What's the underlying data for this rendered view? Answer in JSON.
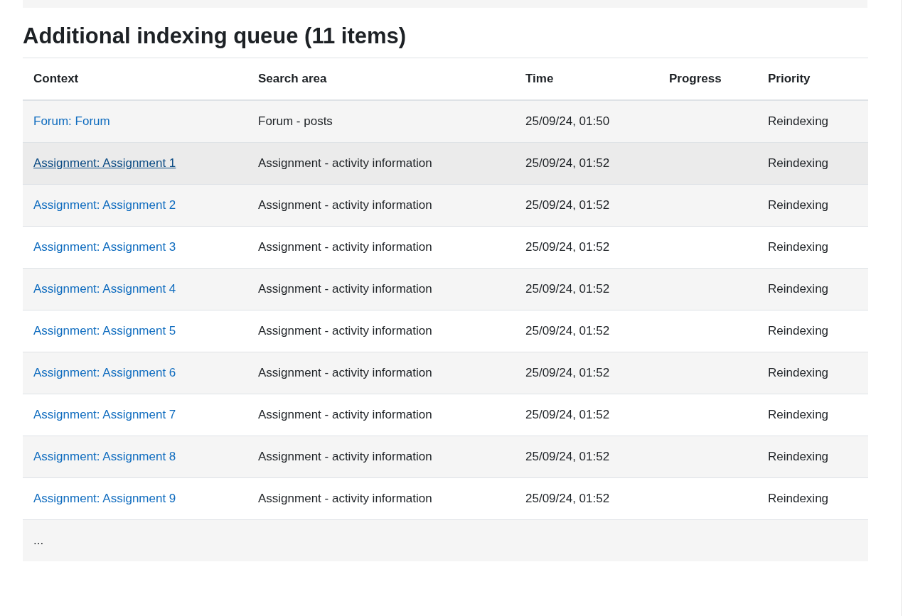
{
  "heading": "Additional indexing queue (11 items)",
  "table": {
    "columns": [
      "Context",
      "Search area",
      "Time",
      "Progress",
      "Priority"
    ],
    "rows": [
      {
        "kind": "entry",
        "hovered": false,
        "context": "Forum: Forum",
        "search_area": "Forum - posts",
        "time": "25/09/24, 01:50",
        "priority": "Reindexing"
      },
      {
        "kind": "entry",
        "hovered": true,
        "context": "Assignment: Assignment 1",
        "search_area": "Assignment - activity information",
        "time": "25/09/24, 01:52",
        "priority": "Reindexing"
      },
      {
        "kind": "entry",
        "hovered": false,
        "context": "Assignment: Assignment 2",
        "search_area": "Assignment - activity information",
        "time": "25/09/24, 01:52",
        "priority": "Reindexing"
      },
      {
        "kind": "entry",
        "hovered": false,
        "context": "Assignment: Assignment 3",
        "search_area": "Assignment - activity information",
        "time": "25/09/24, 01:52",
        "priority": "Reindexing"
      },
      {
        "kind": "entry",
        "hovered": false,
        "context": "Assignment: Assignment 4",
        "search_area": "Assignment - activity information",
        "time": "25/09/24, 01:52",
        "priority": "Reindexing"
      },
      {
        "kind": "entry",
        "hovered": false,
        "context": "Assignment: Assignment 5",
        "search_area": "Assignment - activity information",
        "time": "25/09/24, 01:52",
        "priority": "Reindexing"
      },
      {
        "kind": "entry",
        "hovered": false,
        "context": "Assignment: Assignment 6",
        "search_area": "Assignment - activity information",
        "time": "25/09/24, 01:52",
        "priority": "Reindexing"
      },
      {
        "kind": "entry",
        "hovered": false,
        "context": "Assignment: Assignment 7",
        "search_area": "Assignment - activity information",
        "time": "25/09/24, 01:52",
        "priority": "Reindexing"
      },
      {
        "kind": "entry",
        "hovered": false,
        "context": "Assignment: Assignment 8",
        "search_area": "Assignment - activity information",
        "time": "25/09/24, 01:52",
        "priority": "Reindexing"
      },
      {
        "kind": "entry",
        "hovered": false,
        "context": "Assignment: Assignment 9",
        "search_area": "Assignment - activity information",
        "time": "25/09/24, 01:52",
        "priority": "Reindexing"
      },
      {
        "kind": "more",
        "text": "..."
      }
    ]
  }
}
